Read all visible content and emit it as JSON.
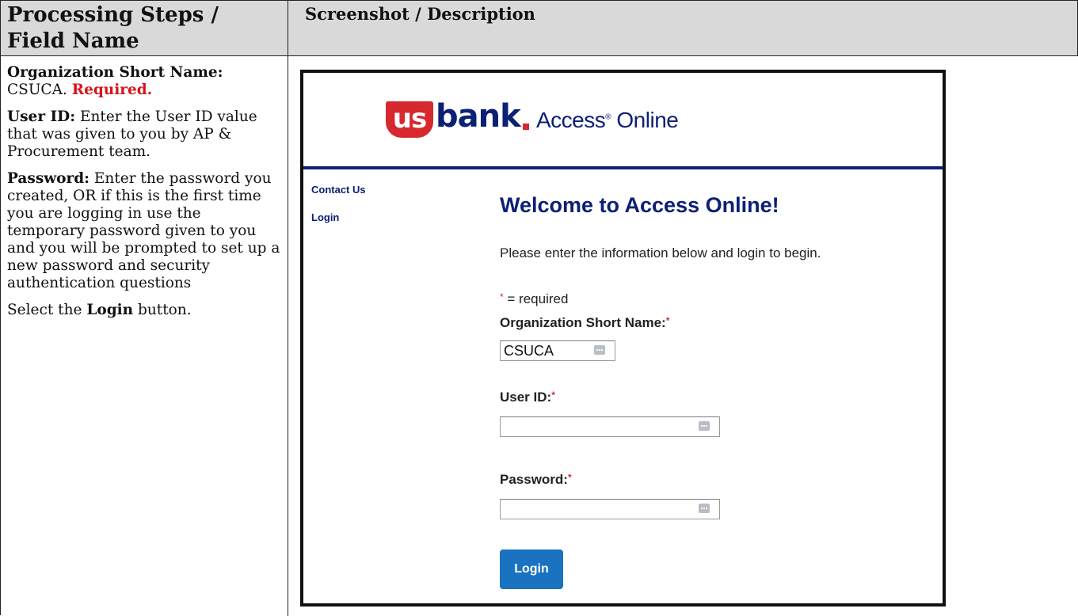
{
  "header": {
    "left_title_line1": "Processing Steps /",
    "left_title_line2": "Field Name",
    "right_title": "Screenshot / Description"
  },
  "instructions": {
    "org_label": "Organization Short Name:",
    "org_value": "CSUCA.",
    "org_required": "Required.",
    "user_label": "User ID:",
    "user_text": "Enter the User ID value that was given to you by AP & Procurement team.",
    "password_label": "Password:",
    "password_text": "Enter the password you created, OR if this is the first time you are logging in use the temporary password given to you and you will be prompted to set up a new password and security authentication questions",
    "select_prefix": "Select the",
    "select_bold": "Login",
    "select_suffix": "button."
  },
  "screenshot": {
    "logo_us": "us",
    "logo_bank": "bank",
    "app_name": "Access",
    "app_name_mark": "®",
    "app_name2": "Online",
    "sidebar": [
      "Contact Us",
      "Login"
    ],
    "welcome": "Welcome to Access Online!",
    "intro": "Please enter the information below and login to begin.",
    "required_note": "= required",
    "org_field_label": "Organization Short Name:",
    "org_field_value": "CSUCA",
    "user_field_label": "User ID:",
    "user_field_value": "",
    "password_field_label": "Password:",
    "password_field_value": "",
    "login_button": "Login"
  },
  "colors": {
    "brand_navy": "#0c2074",
    "brand_red": "#d7282f",
    "button_blue": "#1a73c0",
    "required_red": "#d6141b"
  }
}
